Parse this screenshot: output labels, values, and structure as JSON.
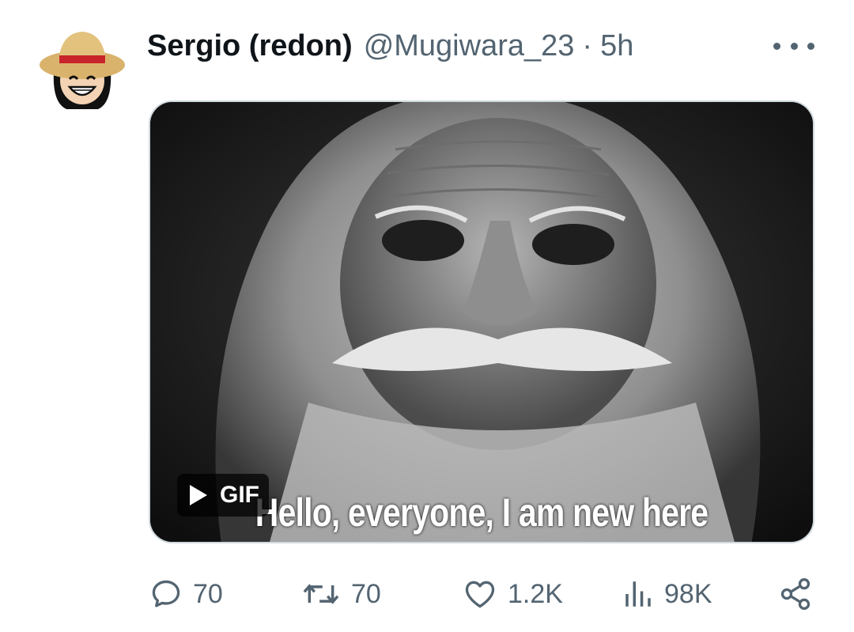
{
  "tweet": {
    "author_name": "Sergio (redon)",
    "author_handle": "@Mugiwara_23",
    "separator": "·",
    "timestamp": "5h",
    "media": {
      "caption": "Hello, everyone, I am new here",
      "badge_label": "GIF"
    }
  },
  "actions": {
    "reply_count": "70",
    "retweet_count": "70",
    "like_count": "1.2K",
    "views_count": "98K"
  },
  "icons": {
    "more": "more-horizontal-icon",
    "reply": "reply-bubble-icon",
    "retweet": "retweet-icon",
    "like": "heart-icon",
    "views": "bar-chart-icon",
    "share": "share-icon",
    "play": "play-icon"
  },
  "colors": {
    "text_primary": "#0f1419",
    "text_secondary": "#536471",
    "media_border": "#cfd9de"
  }
}
